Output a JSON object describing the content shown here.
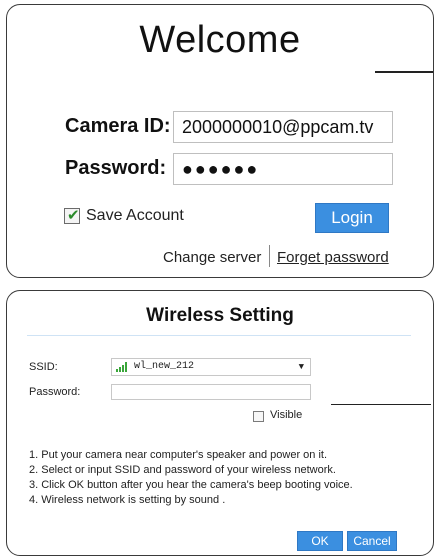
{
  "login": {
    "title": "Welcome",
    "camera_id_label": "Camera ID:",
    "camera_id_value": "2000000010@ppcam.tv",
    "password_label": "Password:",
    "password_value": "●●●●●●",
    "save_account_label": "Save Account",
    "save_account_checked": true,
    "login_button": "Login",
    "change_server_link": "Change server",
    "forget_password_link": "Forget password"
  },
  "wireless": {
    "title": "Wireless Setting",
    "ssid_label": "SSID:",
    "ssid_value": "wl_new_212",
    "password_label": "Password:",
    "password_value": "",
    "visible_label": "Visible",
    "visible_checked": false,
    "instructions": [
      "1. Put your camera near computer's speaker and power on it.",
      "2. Select or input SSID and password of your wireless network.",
      "3. Click OK button after you hear the camera's beep booting voice.",
      "4. Wireless network is setting by sound ."
    ],
    "ok_button": "OK",
    "cancel_button": "Cancel"
  },
  "colors": {
    "button_blue": "#3b8fe0",
    "signal_green": "#3aa63a"
  },
  "icons": {
    "check": "check-icon",
    "signal": "wifi-signal-icon",
    "dropdown": "chevron-down-icon"
  }
}
